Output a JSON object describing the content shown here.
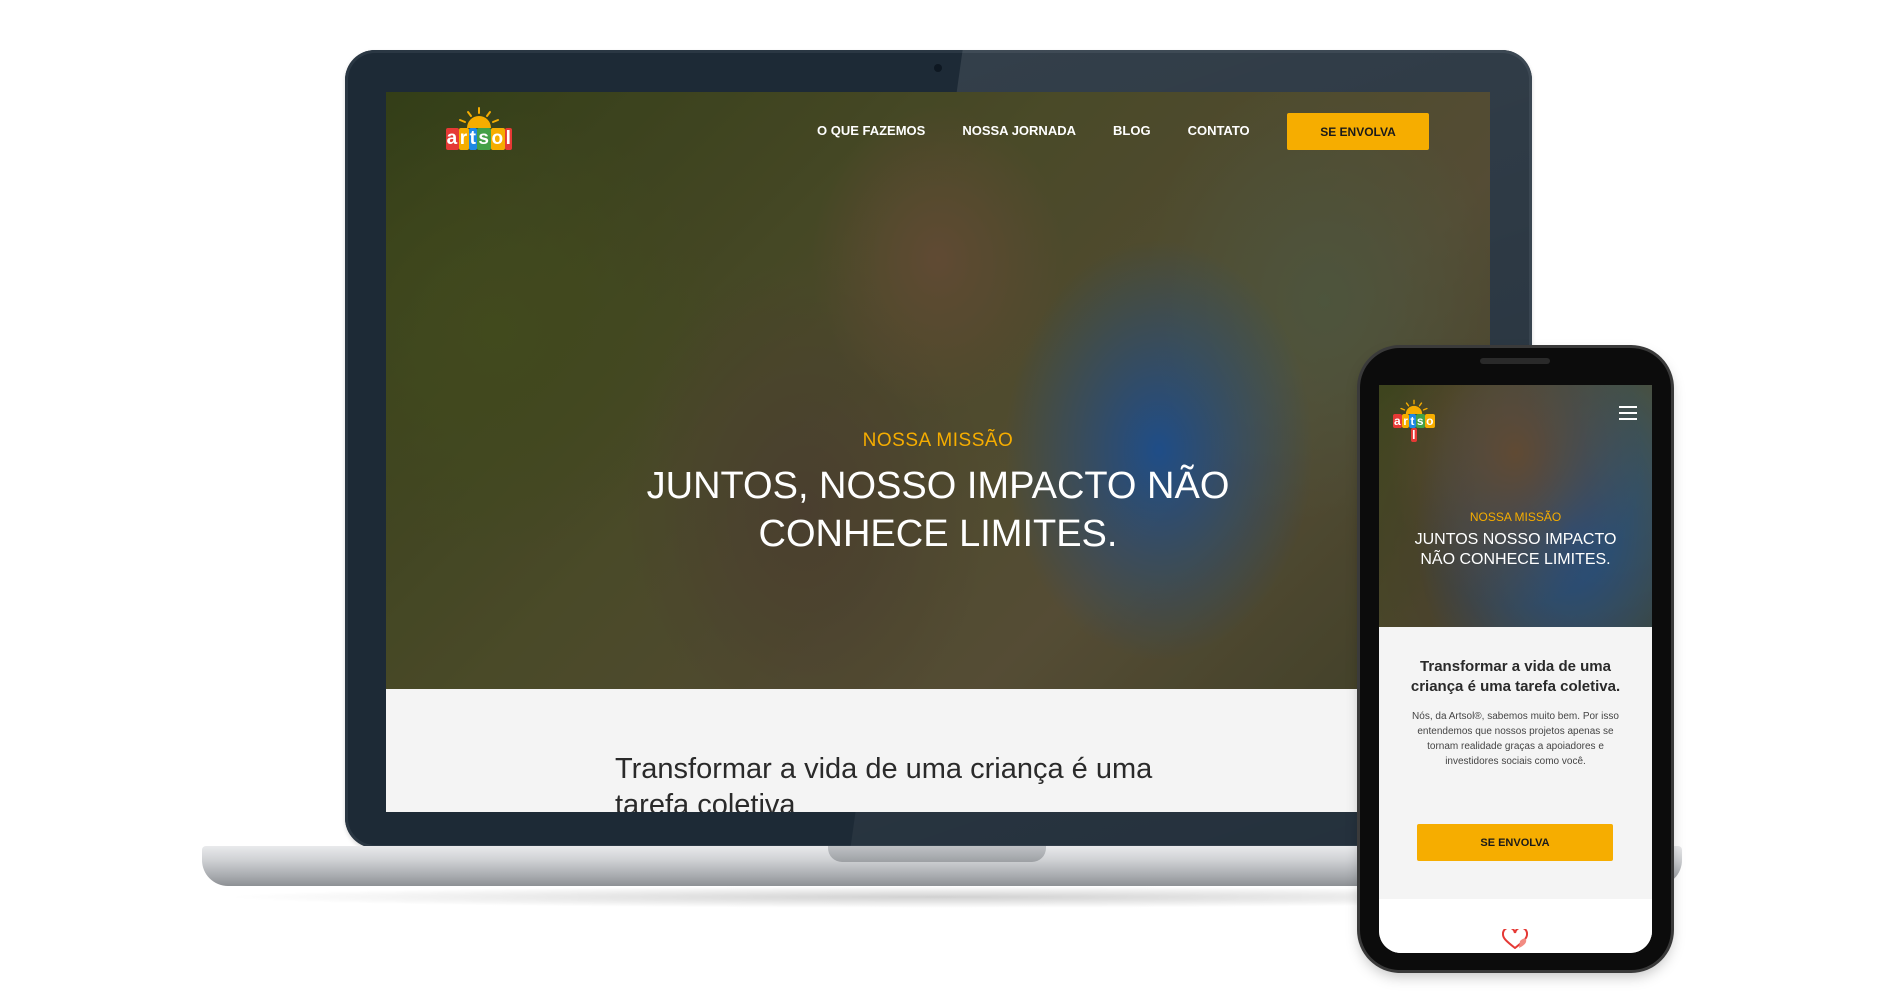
{
  "brand": {
    "logo_text": "artsol",
    "logo_letters": [
      "a",
      "r",
      "t",
      "s",
      "o",
      "l"
    ],
    "colors": {
      "accent": "#f6ad00",
      "logo_letters": [
        "#e53935",
        "#f6ad00",
        "#1e88e5",
        "#43a047",
        "#f6ad00",
        "#e53935"
      ]
    }
  },
  "desktop": {
    "nav": {
      "items": [
        "O QUE FAZEMOS",
        "NOSSA JORNADA",
        "BLOG",
        "CONTATO"
      ],
      "cta_label": "SE ENVOLVA"
    },
    "hero": {
      "kicker": "NOSSA MISSÃO",
      "title_line1": "JUNTOS, NOSSO IMPACTO NÃO",
      "title_line2": "CONHECE LIMITES."
    },
    "intro": {
      "title_line1": "Transformar a vida de uma criança é uma",
      "title_line2": "tarefa coletiva"
    }
  },
  "mobile": {
    "menu_icon": "hamburger-icon",
    "hero": {
      "kicker": "NOSSA MISSÃO",
      "title_line1": "JUNTOS NOSSO IMPACTO",
      "title_line2": "NÃO CONHECE LIMITES."
    },
    "intro": {
      "title_line1": "Transformar a vida de uma",
      "title_line2": "criança é uma tarefa coletiva.",
      "body_lines": [
        "Nós, da Artsol®, sabemos muito bem. Por isso",
        "entendemos que nossos projetos apenas se",
        "tornam realidade graças a apoiadores e",
        "investidores sociais como você."
      ],
      "cta_label": "SE ENVOLVA"
    },
    "footer_icon": "heart-icon"
  }
}
